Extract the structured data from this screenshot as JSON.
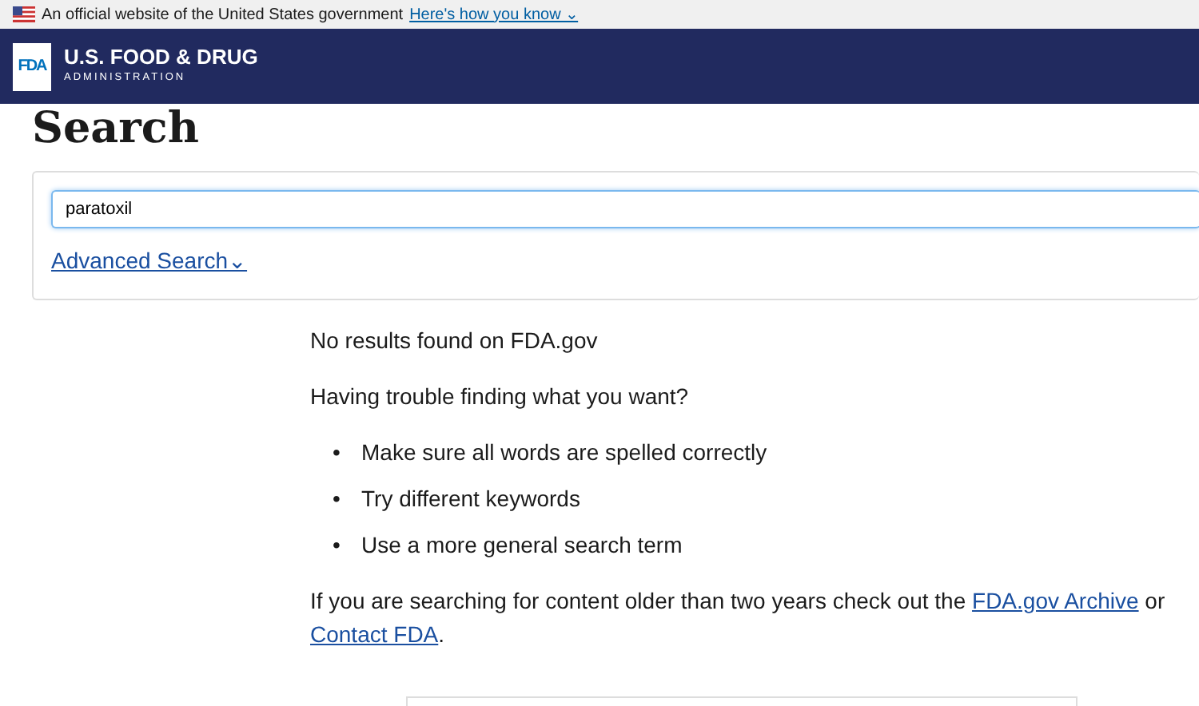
{
  "gov_banner": {
    "text": "An official website of the United States government",
    "link": "Here's how you know",
    "caret": "⌄"
  },
  "header": {
    "logo_mark": "FDA",
    "title": "U.S. FOOD & DRUG",
    "subtitle": "ADMINISTRATION"
  },
  "page_title": "Search",
  "search": {
    "value": "paratoxil",
    "advanced_link": "Advanced Search",
    "advanced_caret": "⌄"
  },
  "results": {
    "message": "No results found on FDA.gov",
    "help_heading": "Having trouble finding what you want?",
    "tip_bullet": "•",
    "tips": [
      "Make sure all words are spelled correctly",
      "Try different keywords",
      "Use a more general search term"
    ],
    "archive_note": {
      "before": "If you are searching for content older than two years check out the ",
      "link1": "FDA.gov Archive",
      "middle": " or ",
      "link2": "Contact FDA",
      "after": "."
    }
  }
}
